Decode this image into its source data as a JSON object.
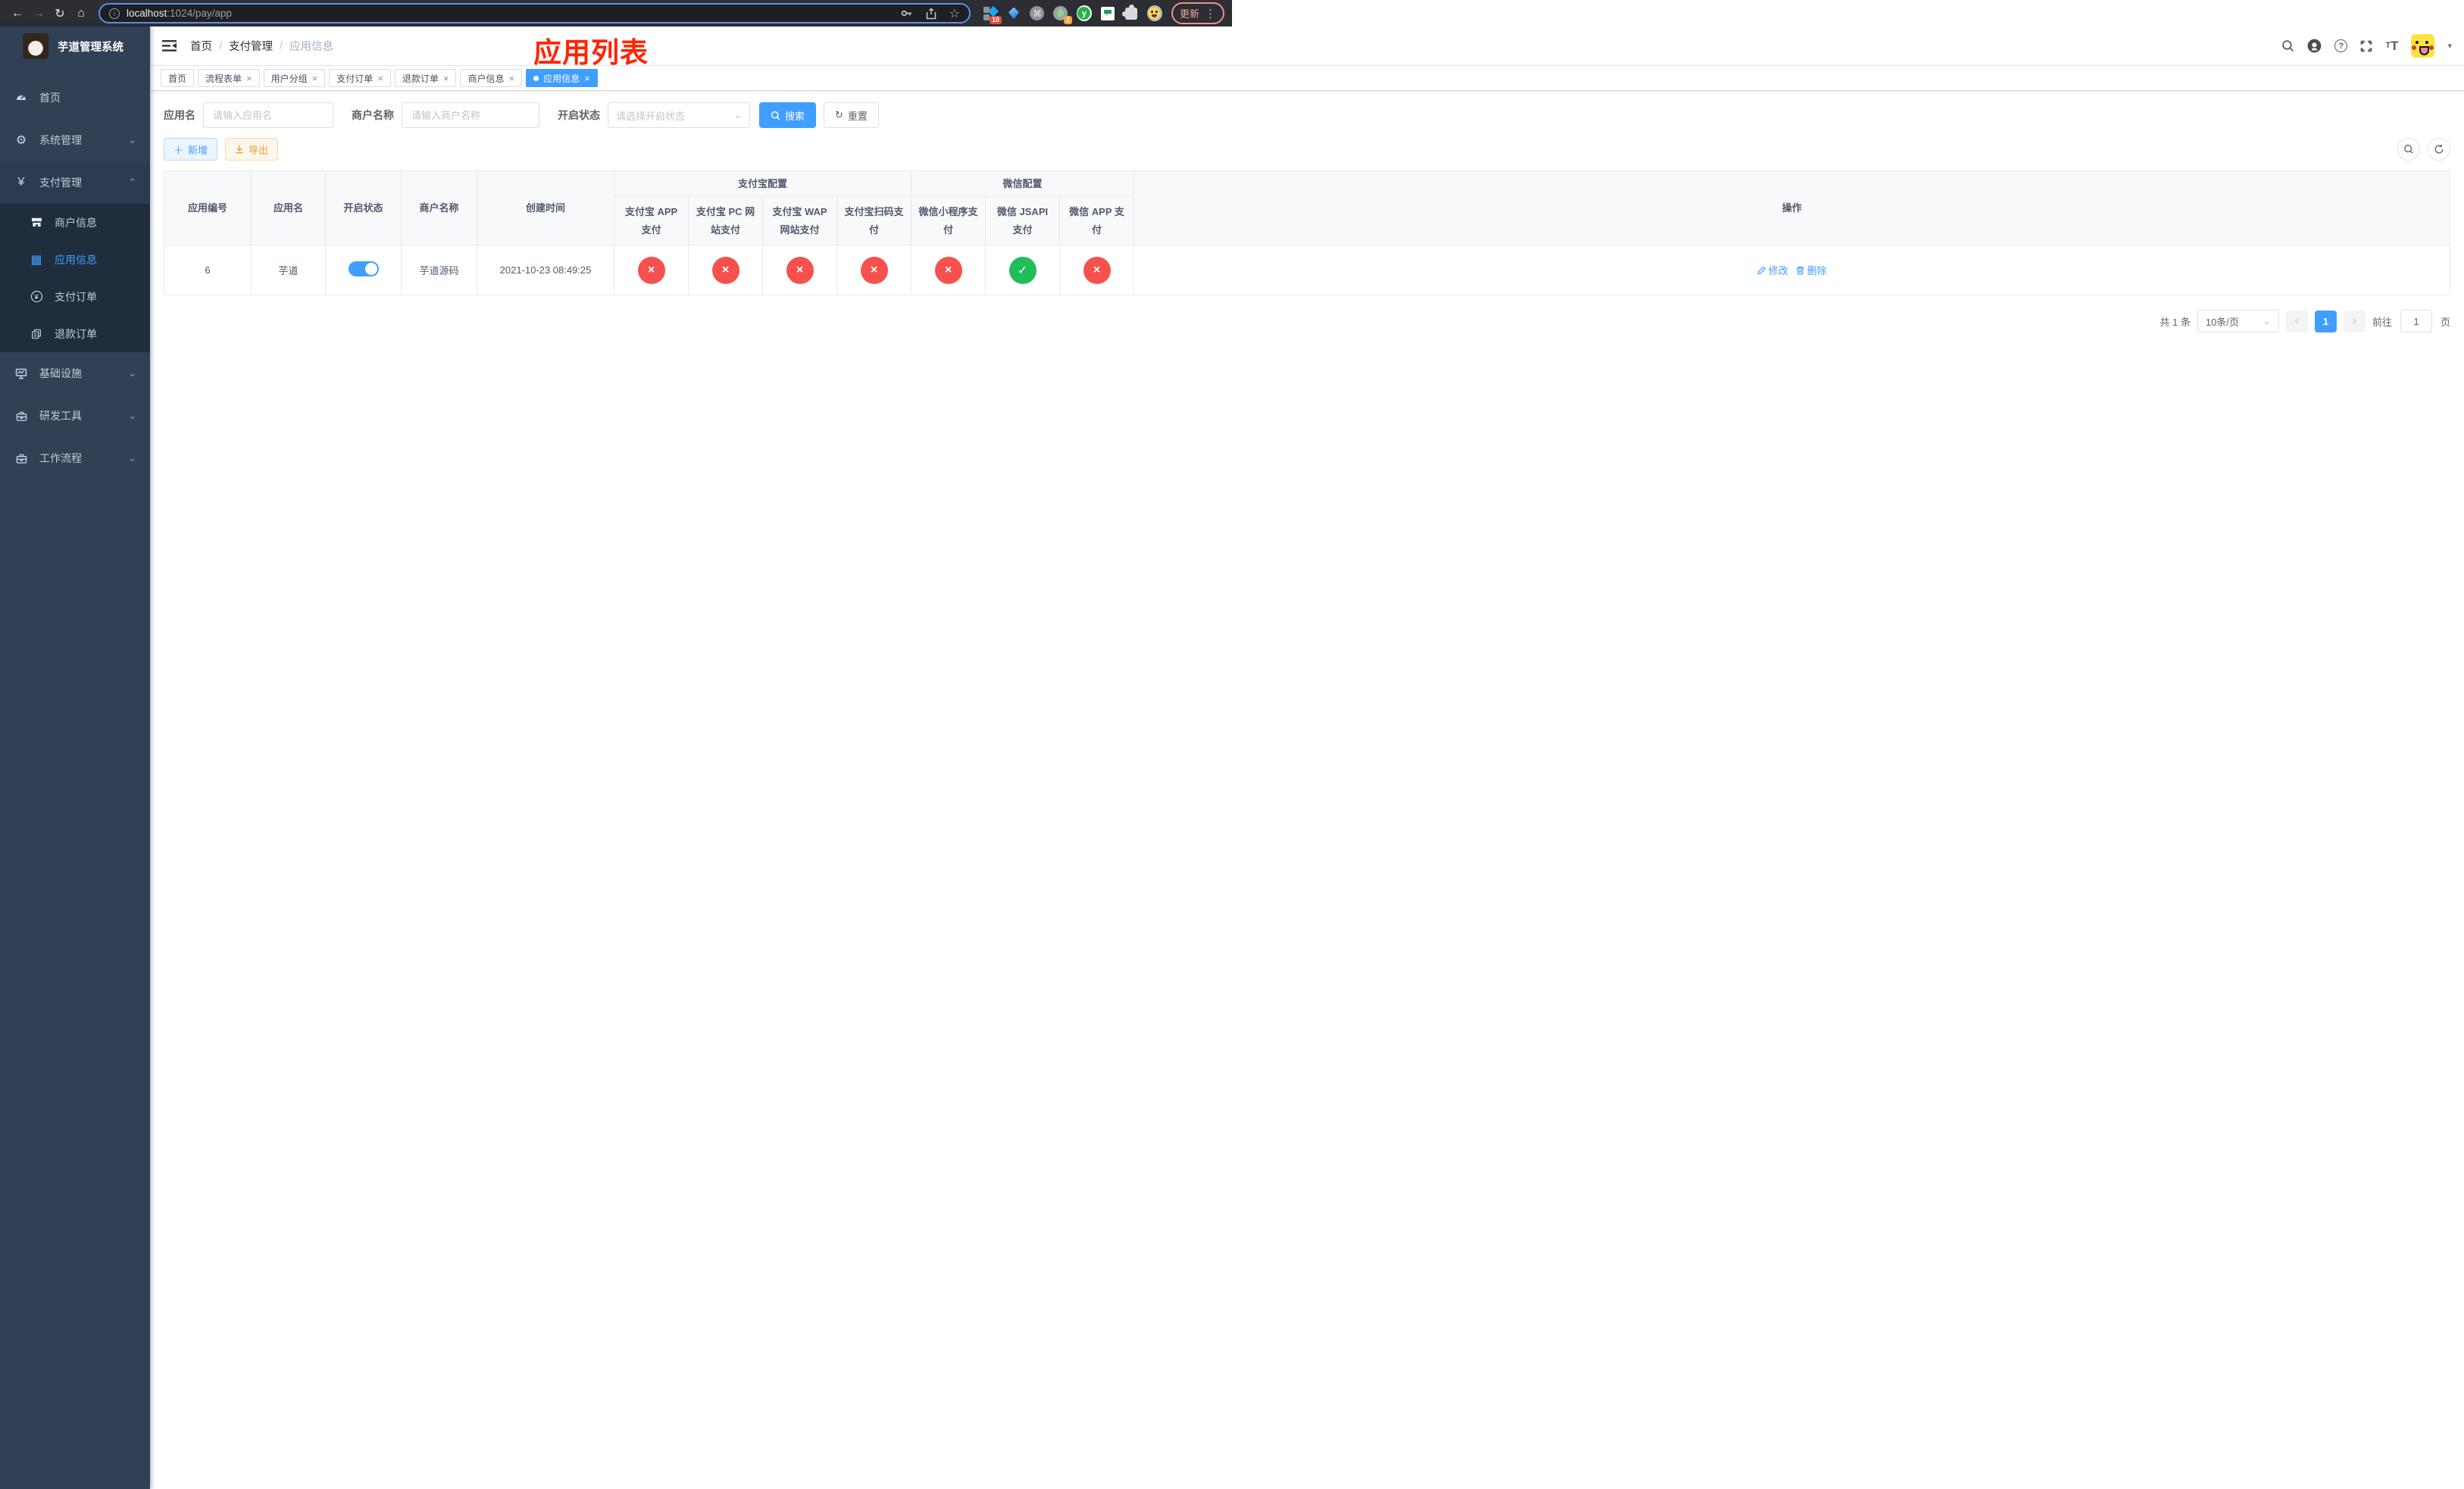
{
  "colors": {
    "accent": "#409eff",
    "danger": "#f6514d",
    "success": "#1fbe5b",
    "sidebar_bg": "#304156",
    "submenu_bg": "#1f2d3d",
    "annotation_red": "#ff2400",
    "warning": "#e6a23c"
  },
  "icons": {
    "back": "←",
    "forward": "→",
    "reload": "↻",
    "home": "⌂",
    "info": "i",
    "star": "☆",
    "command": "⌘",
    "y_logo": "y",
    "kebab": "⋮",
    "gear": "⚙",
    "yen": "¥",
    "grid": "▦",
    "chevron_down": "⌄",
    "chevron_up": "⌃",
    "caret_down": "▾",
    "close": "×",
    "plus": "＋",
    "question": "?",
    "tt_big": "T",
    "tt_small": "T",
    "prev": "‹",
    "next": "›",
    "refresh": "↻"
  },
  "browser": {
    "url_host": "localhost",
    "url_rest": ":1024/pay/app",
    "ext_badge_grid": "10",
    "ext_badge_lens": "1",
    "update_label": "更新"
  },
  "sidebar": {
    "title": "芋道管理系统",
    "items": [
      {
        "label": "首页"
      },
      {
        "label": "系统管理"
      },
      {
        "label": "支付管理",
        "expanded": true,
        "children": [
          {
            "label": "商户信息"
          },
          {
            "label": "应用信息",
            "active": true
          },
          {
            "label": "支付订单"
          },
          {
            "label": "退款订单"
          }
        ]
      },
      {
        "label": "基础设施"
      },
      {
        "label": "研发工具"
      },
      {
        "label": "工作流程"
      }
    ]
  },
  "breadcrumb": {
    "items": [
      "首页",
      "支付管理",
      "应用信息"
    ]
  },
  "annotation": {
    "title": "应用列表"
  },
  "tabs": [
    {
      "label": "首页",
      "closable": false
    },
    {
      "label": "流程表单",
      "closable": true
    },
    {
      "label": "用户分组",
      "closable": true
    },
    {
      "label": "支付订单",
      "closable": true
    },
    {
      "label": "退款订单",
      "closable": true
    },
    {
      "label": "商户信息",
      "closable": true
    },
    {
      "label": "应用信息",
      "closable": true,
      "active": true
    }
  ],
  "filters": {
    "app_name_label": "应用名",
    "app_name_placeholder": "请输入应用名",
    "merchant_label": "商户名称",
    "merchant_placeholder": "请输入商户名称",
    "status_label": "开启状态",
    "status_placeholder": "请选择开启状态",
    "search_label": "搜索",
    "reset_label": "重置"
  },
  "toolbar": {
    "add_label": "新增",
    "export_label": "导出"
  },
  "table": {
    "group_alipay": "支付宝配置",
    "group_wechat": "微信配置",
    "columns": {
      "id": "应用编号",
      "name": "应用名",
      "status": "开启状态",
      "merchant": "商户名称",
      "created": "创建时间",
      "alipay_app": "支付宝 APP 支付",
      "alipay_pc": "支付宝 PC 网站支付",
      "alipay_wap": "支付宝 WAP 网站支付",
      "alipay_qr": "支付宝扫码支付",
      "wx_lite": "微信小程序支付",
      "wx_jsapi": "微信 JSAPI 支付",
      "wx_app": "微信 APP 支付",
      "ops": "操作"
    },
    "row": {
      "id": "6",
      "name": "芋道",
      "enabled": true,
      "merchant": "芋道源码",
      "created": "2021-10-23 08:49:25",
      "statuses": {
        "alipay_app": false,
        "alipay_pc": false,
        "alipay_wap": false,
        "alipay_qr": false,
        "wx_lite": false,
        "wx_jsapi": true,
        "wx_app": false
      },
      "edit_label": "修改",
      "delete_label": "删除"
    }
  },
  "pagination": {
    "total": "共 1 条",
    "page_size": "10条/页",
    "current": "1",
    "goto_prefix": "前往",
    "goto_value": "1",
    "goto_suffix": "页"
  }
}
